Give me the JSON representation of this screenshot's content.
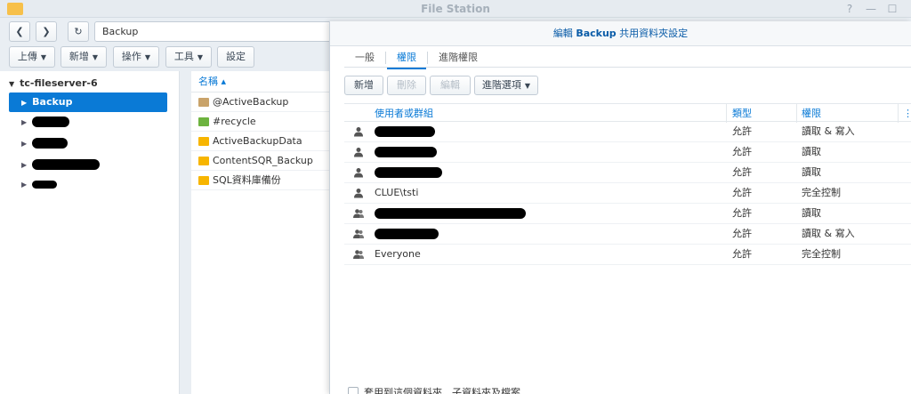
{
  "window": {
    "title": "File Station"
  },
  "toolbar": {
    "path": "Backup",
    "upload": "上傳",
    "create": "新增",
    "action": "操作",
    "tools": "工具",
    "settings": "設定"
  },
  "tree": {
    "root": "tc-fileserver-6",
    "selected": "Backup"
  },
  "filelist": {
    "header": "名稱 ▴",
    "files": [
      {
        "name": "@ActiveBackup",
        "icon": "archive-icon"
      },
      {
        "name": "#recycle",
        "icon": "recycle-icon"
      },
      {
        "name": "ActiveBackupData",
        "icon": "folder-icon"
      },
      {
        "name": "ContentSQR_Backup",
        "icon": "folder-icon"
      },
      {
        "name": "SQL資料庫備份",
        "icon": "folder-icon"
      }
    ]
  },
  "dialog": {
    "title_prefix": "編輯",
    "title_bold": "Backup",
    "title_suffix": "共用資料夾設定",
    "tabs": [
      "一般",
      "權限",
      "進階權限"
    ],
    "buttons": {
      "add": "新增",
      "delete": "刪除",
      "edit": "編輯",
      "advanced": "進階選項"
    },
    "columns": {
      "user": "使用者或群組",
      "type": "類型",
      "perm": "權限"
    },
    "rows": [
      {
        "name": "",
        "redacted": true,
        "group": false,
        "type": "允許",
        "perm": "讀取 & 寫入"
      },
      {
        "name": "",
        "redacted": true,
        "group": false,
        "type": "允許",
        "perm": "讀取"
      },
      {
        "name": "",
        "redacted": true,
        "group": false,
        "type": "允許",
        "perm": "讀取"
      },
      {
        "name": "CLUE\\tsti",
        "redacted": false,
        "group": false,
        "type": "允許",
        "perm": "完全控制"
      },
      {
        "name": "",
        "redacted": true,
        "group": true,
        "type": "允許",
        "perm": "讀取"
      },
      {
        "name": "",
        "redacted": true,
        "group": true,
        "type": "允許",
        "perm": "讀取 & 寫入"
      },
      {
        "name": "Everyone",
        "redacted": false,
        "group": true,
        "type": "允許",
        "perm": "完全控制"
      }
    ],
    "footer": "套用到這個資料夾、子資料夾及檔案"
  },
  "colors": {
    "accent": "#0a7ad6",
    "selected_bg": "#0a7ad6"
  }
}
